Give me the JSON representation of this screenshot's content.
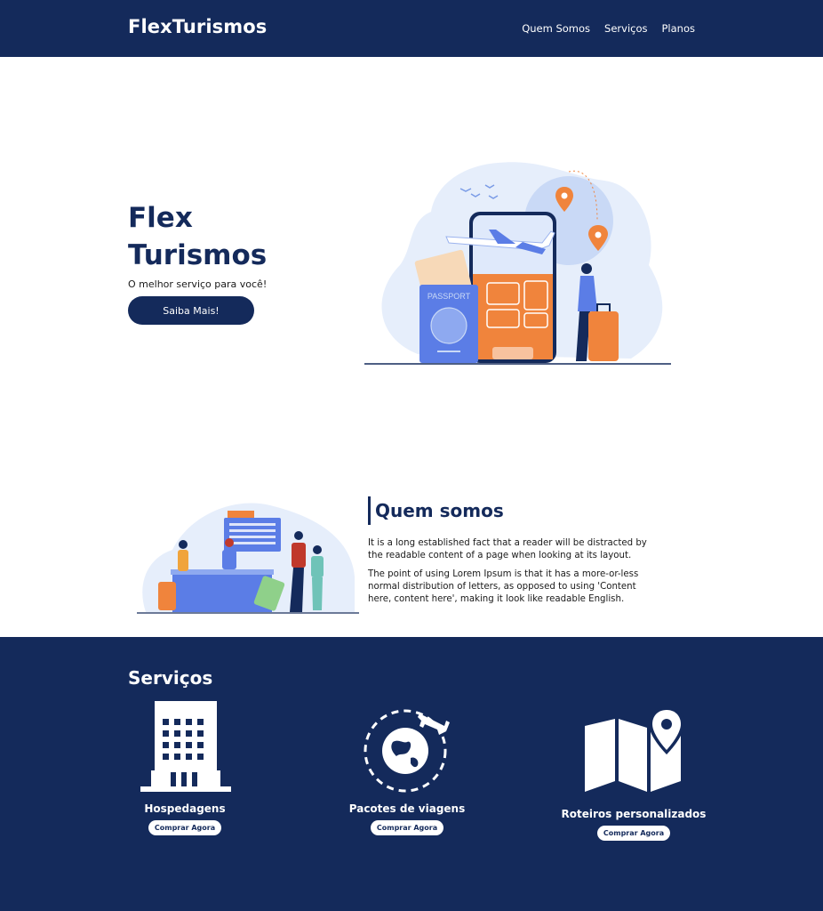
{
  "navbar": {
    "brand": "FlexTurismos",
    "links": [
      "Quem Somos",
      "Serviços",
      "Planos"
    ]
  },
  "hero": {
    "title": "Flex Turismos",
    "subtitle": "O melhor serviço para você!",
    "button_label": "Saiba Mais!",
    "illustration_passport_text": "PASSPORT"
  },
  "about": {
    "title": "Quem somos",
    "paragraphs": [
      "It is a long established fact that a reader will be distracted by the readable content of a page when looking at its layout.",
      "The point of using Lorem Ipsum is that it has a more-or-less normal distribution of letters, as opposed to using 'Content here, content here', making it look like readable English."
    ]
  },
  "services": {
    "title": "Serviços",
    "items": [
      {
        "name": "Hospedagens",
        "button_label": "Comprar Agora",
        "icon": "hotel-building-icon"
      },
      {
        "name": "Pacotes de viagens",
        "button_label": "Comprar Agora",
        "icon": "globe-plane-icon"
      },
      {
        "name": "Roteiros personalizados",
        "button_label": "Comprar Agora",
        "icon": "map-pin-icon"
      }
    ]
  },
  "colors": {
    "primary": "#142a5b",
    "accent_orange": "#f0843c",
    "accent_blue": "#5b7de6",
    "light_blue": "#e6eefb",
    "white": "#ffffff"
  }
}
